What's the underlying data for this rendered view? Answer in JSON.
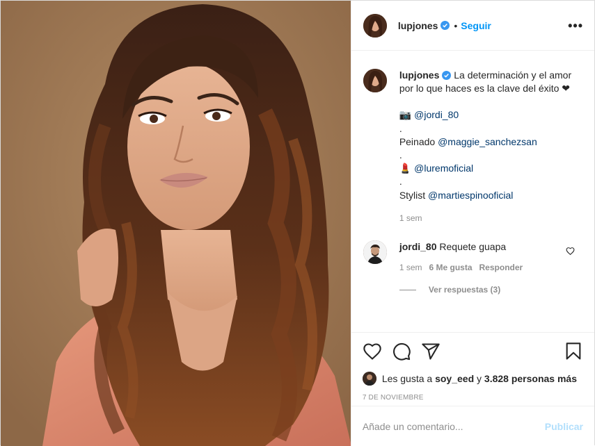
{
  "post": {
    "username": "lupjones",
    "follow_label": "Seguir",
    "separator": "•",
    "more_label": "•••"
  },
  "caption": {
    "username": "lupjones",
    "text_1": "La determinación y el amor por lo que haces es la clave del éxito ❤",
    "line_photo_prefix": "📷",
    "line_photo_mention": "@jordi_80",
    "dot_1": ".",
    "line_hair_prefix": "Peinado",
    "line_hair_mention": "@maggie_sanchezsan",
    "dot_2": ".",
    "line_makeup_prefix": "💄",
    "line_makeup_mention": "@luremoficial",
    "dot_3": ".",
    "line_stylist_prefix": "Stylist",
    "line_stylist_mention": "@martiespinooficial",
    "time": "1 sem"
  },
  "comment": {
    "username": "jordi_80",
    "text": "Requete guapa",
    "time": "1 sem",
    "likes": "6 Me gusta",
    "reply_label": "Responder",
    "view_replies": "Ver respuestas (3)"
  },
  "likes": {
    "prefix": "Les gusta a",
    "user": "soy_eed",
    "middle": "y",
    "count": "3.828 personas más"
  },
  "date": "7 DE NOVIEMBRE",
  "add_comment": {
    "placeholder": "Añade un comentario...",
    "publish_label": "Publicar"
  },
  "icons": {
    "verified": "verified-badge-icon",
    "like": "heart-icon",
    "comment": "comment-bubble-icon",
    "share": "paper-plane-icon",
    "save": "bookmark-icon"
  },
  "colors": {
    "accent": "#0095f6",
    "mention": "#00376b",
    "muted": "#8e8e8e",
    "publish_disabled": "#b2dffc"
  }
}
